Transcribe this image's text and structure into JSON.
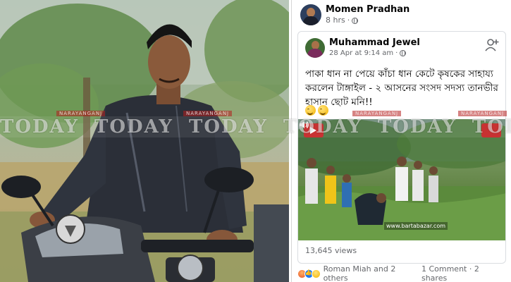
{
  "fb_post": {
    "author": "Momen Pradhan",
    "time": "8 hrs",
    "shared_post": {
      "author": "Muhammad Jewel",
      "time": "28 Apr at 9:14 am",
      "text": "পাকা ধান না পেয়ে কাঁচা ধান কেটে কৃষকের সাহায্য করলেন টাঙ্গাইল - ২ আসনের সংসদ সদস্য তানভীর হাসান ছোট মনি!!",
      "video": {
        "source_url": "www.bartabazar.com"
      },
      "views": "13,645 views"
    },
    "reactions": {
      "names": "Roman Miah and 2 others",
      "comments": "1 Comment",
      "shares": "2 shares"
    }
  },
  "watermark": {
    "word": "TODAY",
    "tag": "NARAYANGANJ"
  },
  "icons": {
    "globe": "globe-icon",
    "add_friend": "add-friend-icon",
    "volume": "volume-icon",
    "play_logo": "play-logo-icon",
    "reaction_angry": "angry-reaction-icon",
    "reaction_like": "like-reaction-icon",
    "reaction_wow": "wow-reaction-icon",
    "emoji": "grinning-face-icon"
  },
  "colors": {
    "fb_text": "#050505",
    "fb_meta": "#65676b",
    "like_blue": "#1877f2",
    "logo_red": "#c42121"
  }
}
